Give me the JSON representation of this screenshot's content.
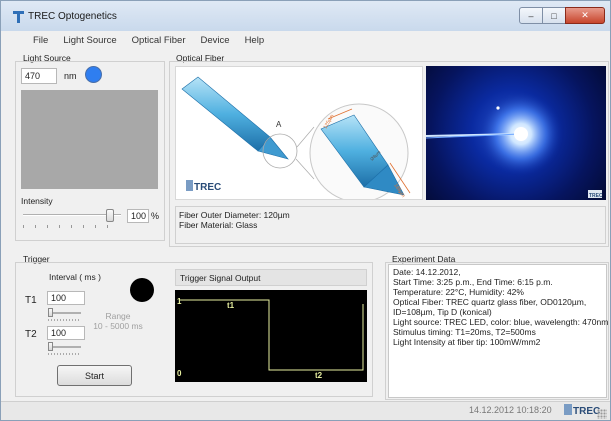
{
  "window": {
    "title": "TREC Optogenetics",
    "controls": {
      "minimize": "–",
      "maximize": "□",
      "close": "✕"
    }
  },
  "menu": [
    "File",
    "Light Source",
    "Optical Fiber",
    "Device",
    "Help"
  ],
  "light_source": {
    "title": "Light Source",
    "wavelength": "470",
    "unit": "nm",
    "indicator_color": "#2f7ef0",
    "intensity_label": "Intensity",
    "intensity_value": "100",
    "intensity_fraction": 0.92,
    "intensity_unit": "%"
  },
  "optical_fiber": {
    "title": "Optical Fiber",
    "diagram": {
      "detail_label": "A",
      "dim_diameter": "125µm",
      "dim_length": "188µm",
      "dim_tip": "Ø8µm",
      "logo": "TREC"
    },
    "photo_logo": "TREC",
    "info_lines": [
      "Fiber Outer Diameter: 120µm",
      "Fiber Material: Glass"
    ]
  },
  "trigger": {
    "title": "Trigger",
    "interval_label": "Interval ( ms )",
    "t1_label": "T1",
    "t1_value": "100",
    "t2_label": "T2",
    "t2_value": "100",
    "range_label": "Range",
    "range_value": "10 - 5000 ms",
    "start_label": "Start",
    "status_color": "#000000",
    "signal_title": "Trigger Signal Output",
    "signal": {
      "high": "1",
      "low": "0",
      "t1": "t1",
      "t2": "t2",
      "line_color": "#e8f0a0"
    }
  },
  "experiment": {
    "title": "Experiment Data",
    "lines": [
      "Date: 14.12.2012,",
      "Start Time: 3:25 p.m., End Time: 6:15 p.m.",
      "Temperature: 22°C, Humidity: 42%",
      "Optical Fiber: TREC quartz glass fiber, OD0120µm,",
      "ID=108µm, Tip D (konical)",
      "Light source: TREC LED, color: blue, wavelength: 470nm",
      "Stimulus timing: T1=20ms, T2=500ms",
      "Light Intensity at fiber tip: 100mW/mm2"
    ]
  },
  "status": {
    "datetime": "14.12.2012 10:18:20",
    "logo": "TREC"
  }
}
